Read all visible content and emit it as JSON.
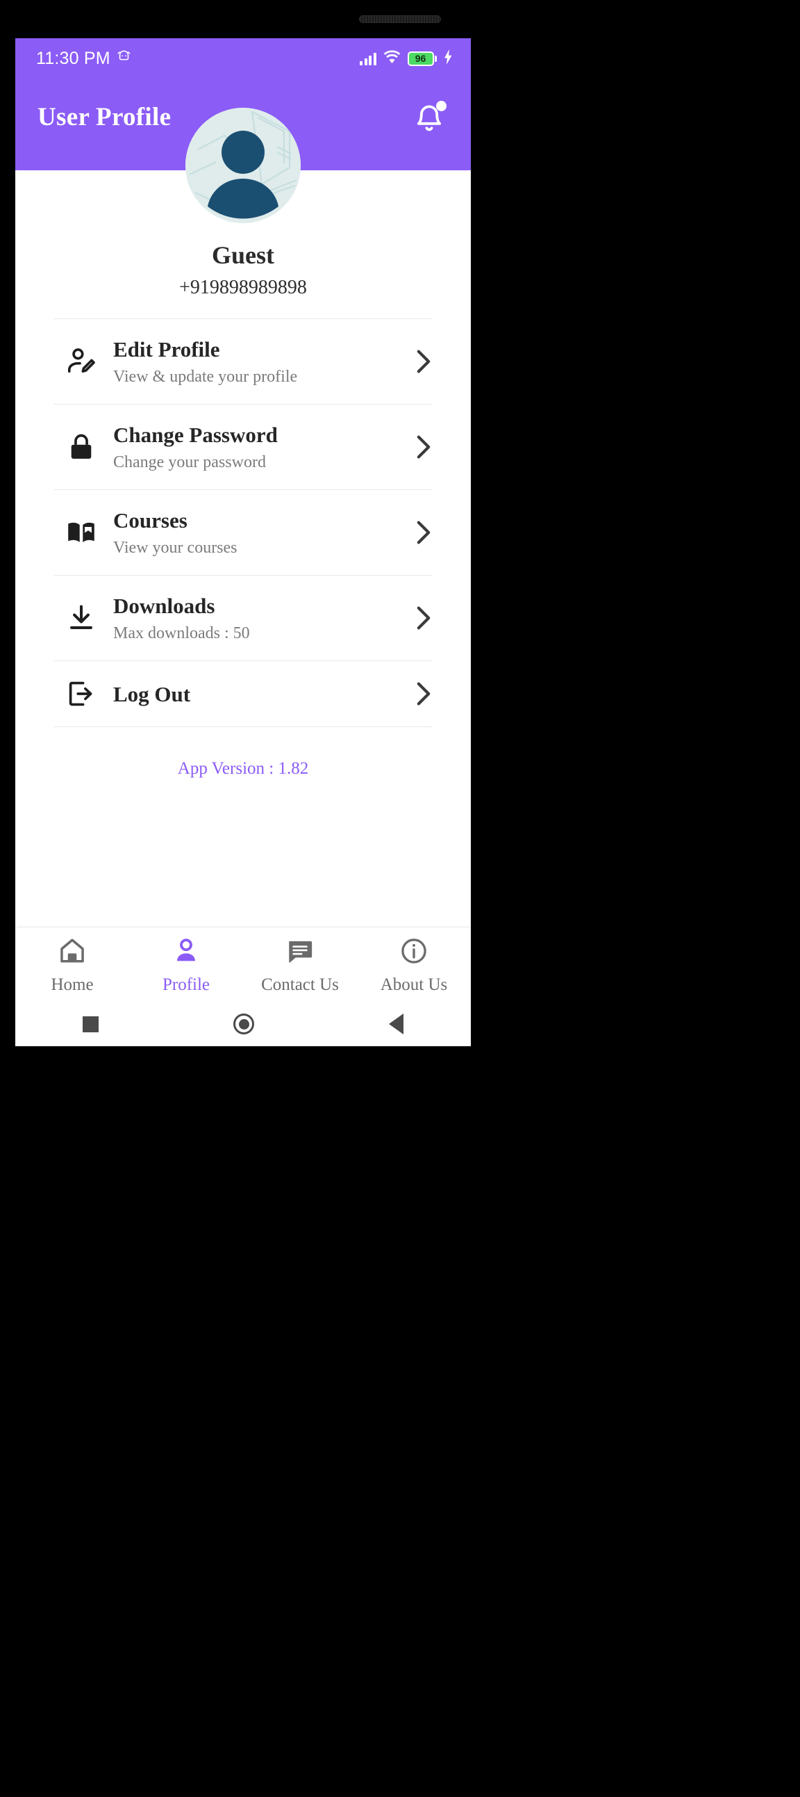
{
  "colors": {
    "accent": "#8B5CF6",
    "battery_green": "#4CD964",
    "avatar_figure": "#1B4F72",
    "avatar_bg": "#dfeceb",
    "nav_inactive": "#6b6b6b",
    "text_primary": "#262626",
    "text_secondary": "#7b7b7b"
  },
  "status_bar": {
    "time": "11:30 PM",
    "alarm_icon": "alarm-icon",
    "signal_icon": "cellular-signal-icon",
    "wifi_icon": "wifi-icon",
    "battery_level": "96",
    "battery_icon": "battery-icon",
    "charging_icon": "charging-bolt-icon"
  },
  "app_bar": {
    "title": "User Profile",
    "notification_icon": "bell-icon",
    "has_notification_badge": true
  },
  "profile": {
    "avatar_icon": "user-avatar-image",
    "name": "Guest",
    "phone": "+919898989898"
  },
  "menu": {
    "items": [
      {
        "icon": "edit-profile-icon",
        "title": "Edit Profile",
        "subtitle": "View & update your profile",
        "chevron": "chevron-right-icon"
      },
      {
        "icon": "lock-icon",
        "title": "Change Password",
        "subtitle": "Change your password",
        "chevron": "chevron-right-icon"
      },
      {
        "icon": "book-icon",
        "title": "Courses",
        "subtitle": "View your courses",
        "chevron": "chevron-right-icon"
      },
      {
        "icon": "download-icon",
        "title": "Downloads",
        "subtitle": "Max downloads : 50",
        "chevron": "chevron-right-icon"
      },
      {
        "icon": "logout-icon",
        "title": "Log Out",
        "subtitle": "",
        "chevron": "chevron-right-icon"
      }
    ]
  },
  "footer": {
    "app_version": "App Version : 1.82"
  },
  "bottom_nav": {
    "items": [
      {
        "icon": "home-icon",
        "label": "Home",
        "active": false
      },
      {
        "icon": "person-icon",
        "label": "Profile",
        "active": true
      },
      {
        "icon": "chat-icon",
        "label": "Contact Us",
        "active": false
      },
      {
        "icon": "info-icon",
        "label": "About Us",
        "active": false
      }
    ]
  },
  "system_nav": {
    "recent_icon": "square-recents-icon",
    "home_icon": "circle-home-icon",
    "back_icon": "triangle-back-icon"
  }
}
